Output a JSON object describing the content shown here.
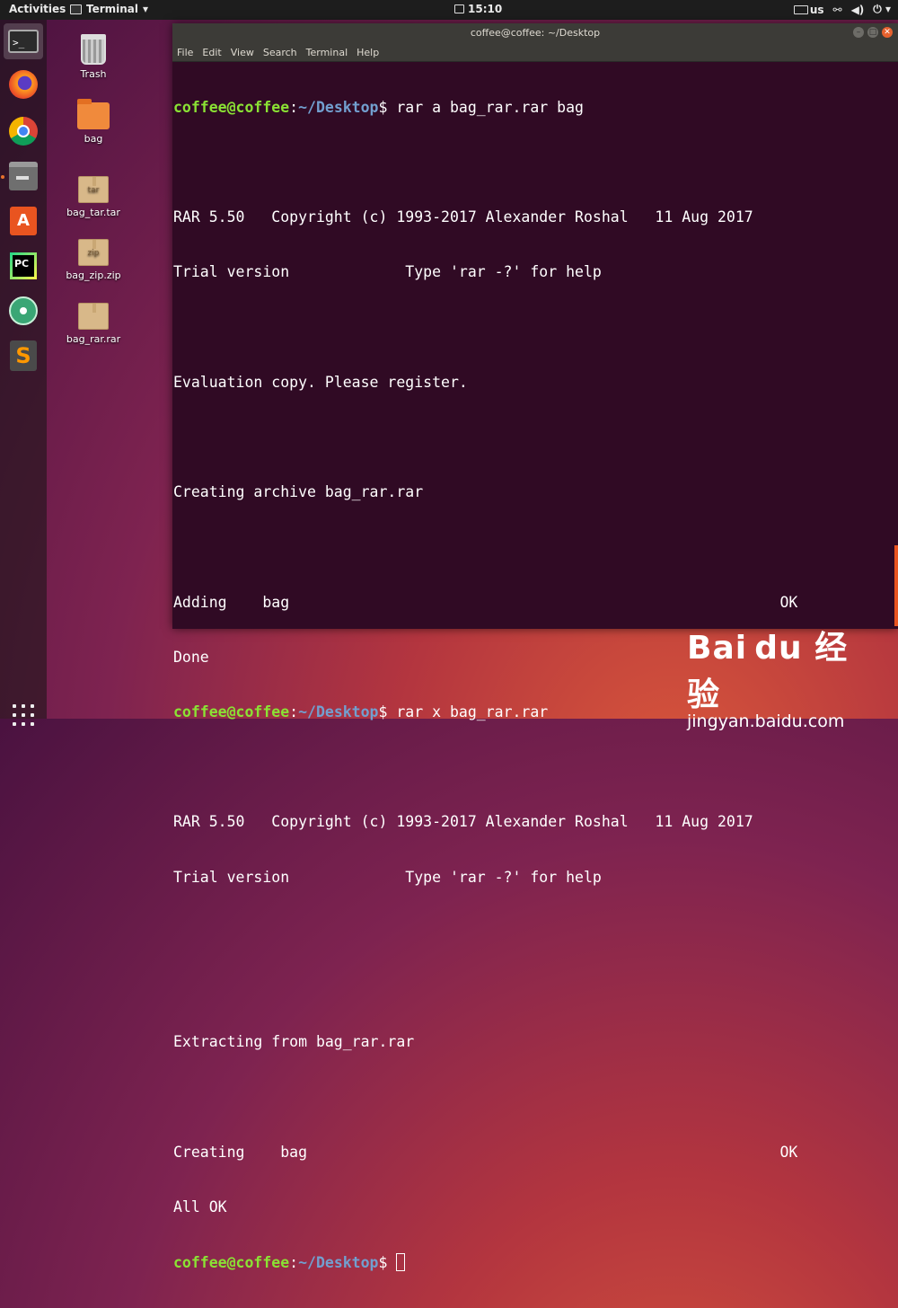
{
  "topbar": {
    "activities": "Activities",
    "app_menu": "Terminal",
    "clock": "15:10",
    "keyboard_layout": "us"
  },
  "desktop": {
    "items": [
      {
        "label": "Trash",
        "icon": "trash-icon"
      },
      {
        "label": "bag",
        "icon": "folder-icon"
      },
      {
        "label": "bag_tar.tar",
        "icon": "archive-icon",
        "badge": "tar"
      },
      {
        "label": "bag_zip.zip",
        "icon": "archive-icon",
        "badge": "zip"
      },
      {
        "label": "bag_rar.rar",
        "icon": "archive-icon",
        "badge": ""
      }
    ]
  },
  "dock": {
    "items": [
      "terminal-icon",
      "firefox-icon",
      "chrome-icon",
      "files-icon",
      "software-store-icon",
      "pycharm-icon",
      "atom-icon",
      "sublime-text-icon"
    ],
    "store_glyph": "A",
    "pycharm_glyph": "PC"
  },
  "terminal": {
    "title": "coffee@coffee: ~/Desktop",
    "menu": [
      "File",
      "Edit",
      "View",
      "Search",
      "Terminal",
      "Help"
    ],
    "prompt_user": "coffee@coffee",
    "prompt_sep": ":",
    "prompt_path": "~/Desktop",
    "prompt_end": "$ ",
    "lines": {
      "cmd1": "rar a bag_rar.rar bag",
      "blank": "",
      "rar_header": "RAR 5.50   Copyright (c) 1993-2017 Alexander Roshal   11 Aug 2017",
      "trial": "Trial version             Type 'rar -?' for help",
      "evaluation": "Evaluation copy. Please register.",
      "creating_archive": "Creating archive bag_rar.rar",
      "adding": "Adding    bag                                                       OK",
      "done": "Done",
      "cmd2": "rar x bag_rar.rar",
      "extracting": "Extracting from bag_rar.rar",
      "creating_bag": "Creating    bag                                                     OK",
      "all_ok": "All OK"
    }
  },
  "watermark": {
    "logo": "Bai du 经验",
    "url": "jingyan.baidu.com"
  },
  "colors": {
    "terminal_bg": "#300a24",
    "prompt_user": "#8ae234",
    "prompt_path": "#729fcf",
    "accent": "#e95420"
  }
}
